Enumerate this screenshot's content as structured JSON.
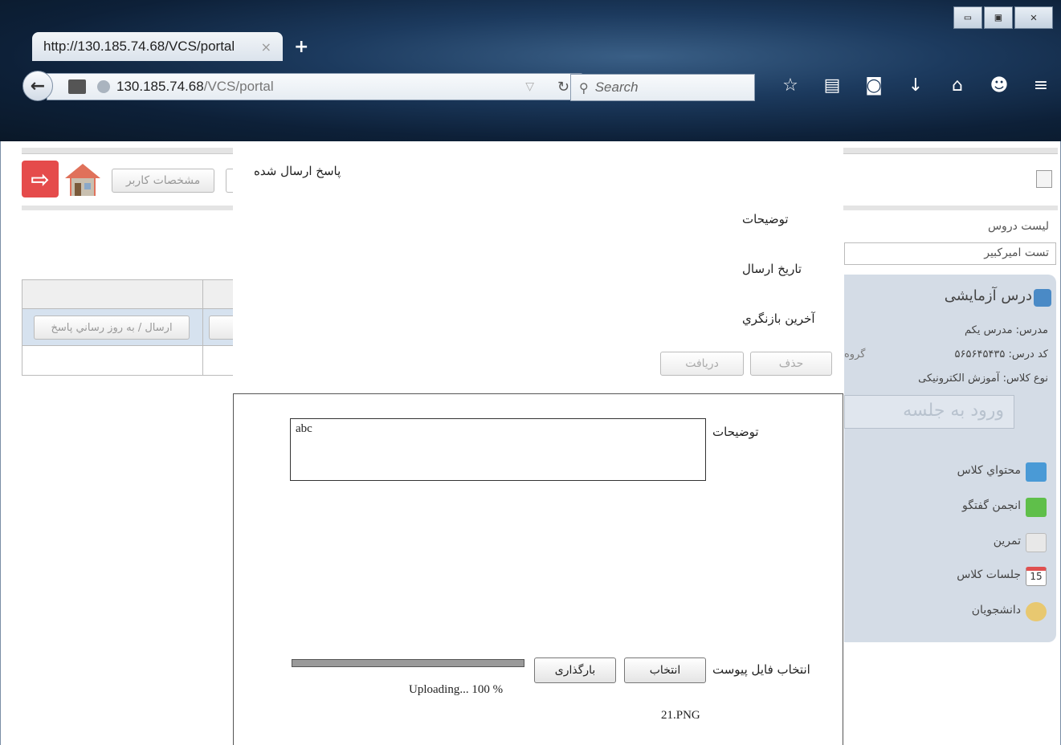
{
  "browser": {
    "tab_title": "http://130.185.74.68/VCS/portal",
    "tab_close": "×",
    "new_tab": "+",
    "url_host": "130.185.74.68",
    "url_path": "/VCS/portal",
    "search_placeholder": "Search",
    "window_controls": [
      "▭",
      "▣",
      "✕"
    ],
    "toolbar_icons": [
      "bookmark-star-icon",
      "reading-list-icon",
      "pocket-icon",
      "download-icon",
      "home-icon",
      "chat-icon",
      "menu-icon"
    ]
  },
  "header": {
    "user_button": "مشخصات کاربر"
  },
  "sidebar": {
    "title": "لیست دروس",
    "course_select": "تست امیرکبیر",
    "course_name": "درس آزمایشی",
    "teacher_label": "مدرس:",
    "teacher_value": "مدرس یکم",
    "code_label": "کد درس:",
    "code_value": "۵۶۵۶۴۵۴۳۵",
    "group_label": "گروه",
    "class_type_label": "نوع کلاس:",
    "class_type_value": "آموزش الکترونیکی",
    "enter_session": "ورود به جلسه",
    "menu": [
      "محتواي کلاس",
      "انجمن گفتگو",
      "تمرین",
      "جلسات کلاس",
      "دانشجويان"
    ]
  },
  "table": {
    "send_button": "ارسال / به روز رساني پاسخ"
  },
  "modal": {
    "title": "پاسخ ارسال شده",
    "desc_label": "توضیحات",
    "date_label": "تاریخ ارسال",
    "last_review_label": "آخرین بازنگري",
    "delete_button": "حذف",
    "receive_button": "دریافت",
    "form": {
      "desc_label": "توضیحات",
      "desc_value": "abc",
      "file_label": "انتخاب فایل پیوست",
      "choose_button": "انتخاب",
      "upload_button": "بارگذاری",
      "upload_status": "Uploading... 100 %",
      "upload_progress": 1.0,
      "file_name": "21.PNG"
    }
  }
}
